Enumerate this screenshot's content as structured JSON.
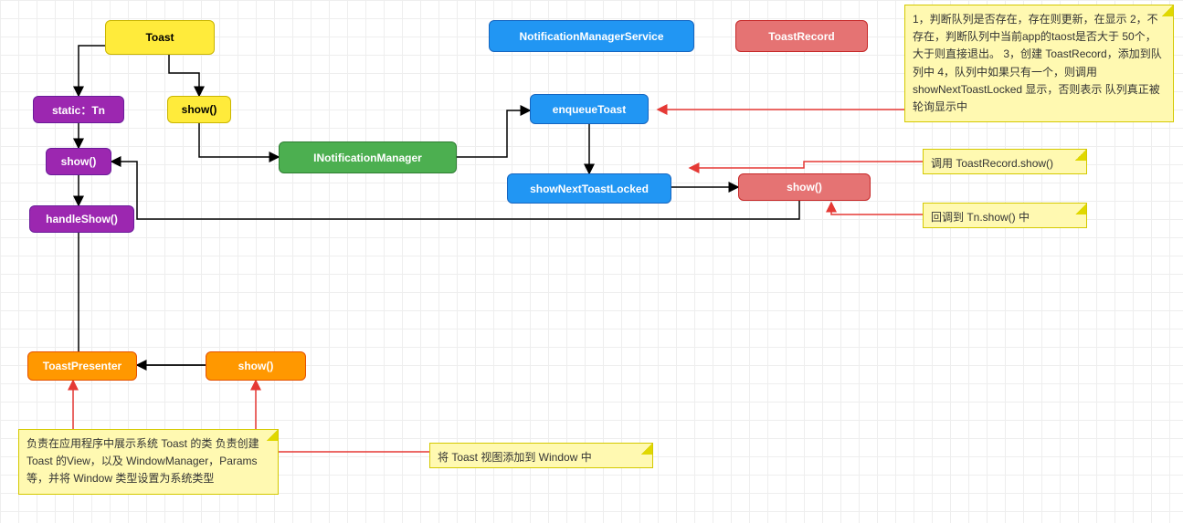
{
  "nodes": {
    "toast": "Toast",
    "staticTn": "static：Tn",
    "show1": "show()",
    "show2": "show()",
    "handleShow": "handleShow()",
    "inotificationManager": "INotificationManager",
    "nms": "NotificationManagerService",
    "enqueueToast": "enqueueToast",
    "showNextToastLocked": "showNextToastLocked",
    "toastRecord": "ToastRecord",
    "showRec": "show()",
    "toastPresenter": "ToastPresenter",
    "showPresenter": "show()"
  },
  "notes": {
    "n1": "1，判断队列是否存在，存在则更新，在显示\n2，不存在，判断队列中当前app的taost是否大于 50个，大于则直接退出。\n3，创建 ToastRecord，添加到队列中\n4，队列中如果只有一个，则调用 showNextToastLocked 显示，否则表示 队列真正被轮询显示中",
    "n2": "调用 ToastRecord.show()",
    "n3": "回调到 Tn.show() 中",
    "n4": "负责在应用程序中展示系统 Toast 的类\n\n负责创建 Toast 的View，以及 WindowManager，Params 等，并将 Window 类型设置为系统类型",
    "n5": "将 Toast 视图添加到 Window 中"
  }
}
